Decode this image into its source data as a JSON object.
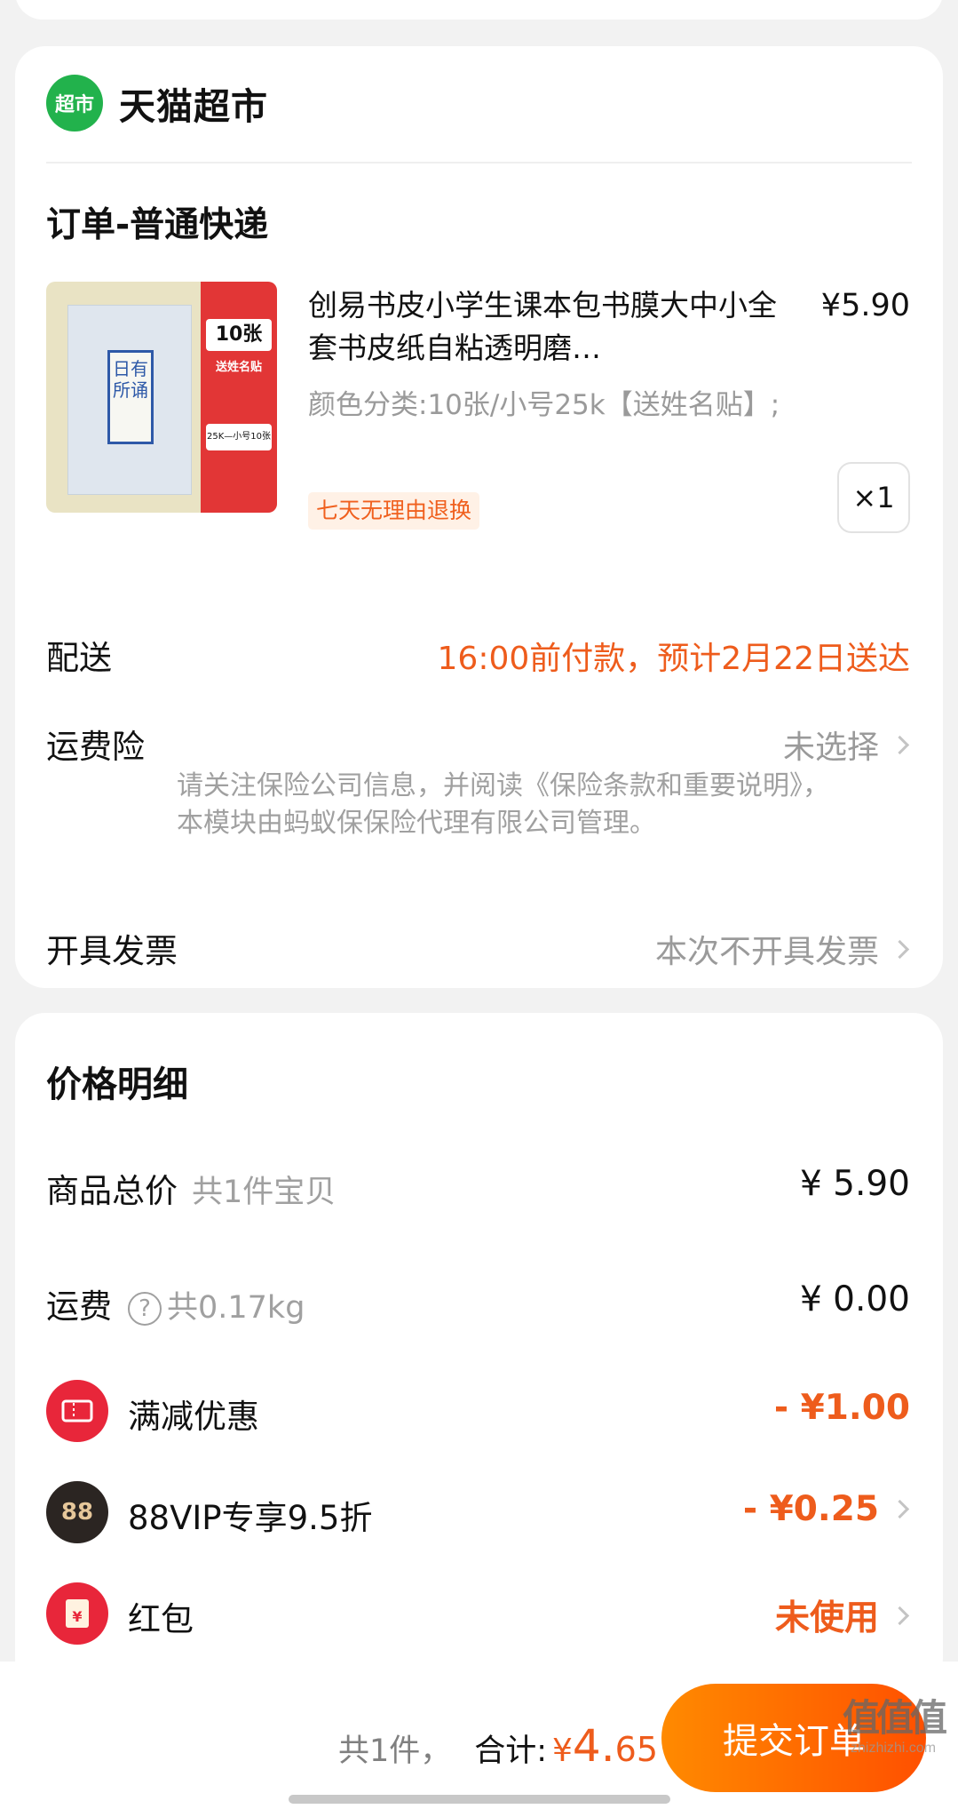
{
  "shop": {
    "logo_text": "超市",
    "name": "天猫超市"
  },
  "order": {
    "section_title": "订单-普通快递",
    "product": {
      "title": "创易书皮小学生课本包书膜大中小全套书皮纸自粘透明磨…",
      "price": "¥5.90",
      "spec": "颜色分类:10张/小号25k【送姓名贴】;",
      "tag": "七天无理由退换",
      "quantity": "×1",
      "image": {
        "cover_text": "日有所诵",
        "badge_count": "10张",
        "badge_gift": "送姓名贴",
        "badge_size": "25K—小号10张"
      }
    },
    "delivery": {
      "label": "配送",
      "value": "16:00前付款，预计2月22日送达"
    },
    "shipping_insurance": {
      "label": "运费险",
      "value": "未选择",
      "note": "请关注保险公司信息，并阅读《保险条款和重要说明》，本模块由蚂蚁保保险代理有限公司管理。"
    },
    "invoice": {
      "label": "开具发票",
      "value": "本次不开具发票"
    }
  },
  "price_detail": {
    "title": "价格明细",
    "goods_total": {
      "label": "商品总价",
      "sub": "共1件宝贝",
      "amount": "¥ 5.90"
    },
    "shipping": {
      "label": "运费",
      "help": "?",
      "sub": "共0.17kg",
      "amount": "¥ 0.00"
    },
    "full_reduction": {
      "label": "满减优惠",
      "amount": "- ¥1.00"
    },
    "vip": {
      "icon_text": "88",
      "label": "88VIP专享9.5折",
      "amount": "- ¥0.25"
    },
    "red_packet": {
      "icon_text": "¥",
      "label": "红包",
      "amount": "未使用"
    }
  },
  "bottom": {
    "count": "共1件，",
    "total_label": "合计:",
    "yen": "¥",
    "total_int": "4.",
    "total_dec": "65",
    "submit": "提交订单"
  },
  "watermark": {
    "glyph": "值值值",
    "text": "zhizhizhi.com"
  },
  "colors": {
    "accent": "#ee5c1c",
    "button_gradient_start": "#ff8a00",
    "button_gradient_end": "#ff5000",
    "shop_logo": "#22b24c"
  }
}
